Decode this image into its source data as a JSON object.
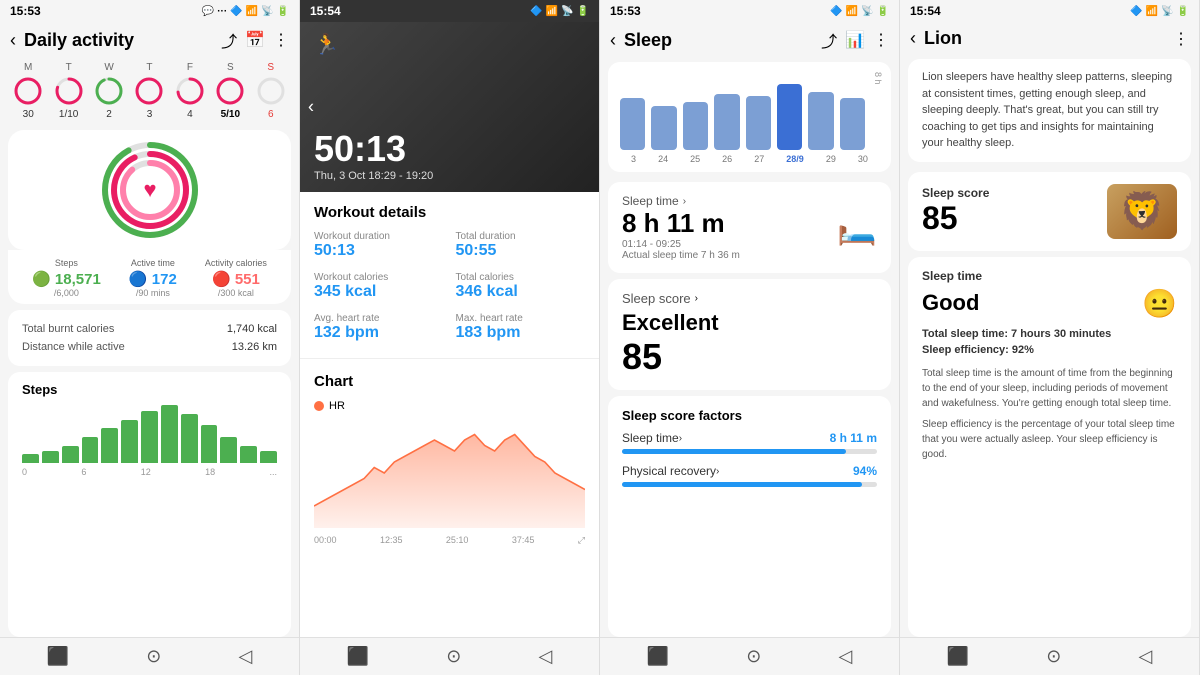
{
  "panel1": {
    "status_time": "15:53",
    "title": "Daily activity",
    "days": [
      {
        "label": "M",
        "num": "30",
        "active": false,
        "sunday": false
      },
      {
        "label": "T",
        "num": "1/10",
        "active": false,
        "sunday": false
      },
      {
        "label": "W",
        "num": "2",
        "active": false,
        "sunday": false
      },
      {
        "label": "T",
        "num": "3",
        "active": false,
        "sunday": false
      },
      {
        "label": "F",
        "num": "4",
        "active": false,
        "sunday": false
      },
      {
        "label": "S",
        "num": "5/10",
        "active": true,
        "sunday": false
      },
      {
        "label": "S",
        "num": "6",
        "active": false,
        "sunday": true
      }
    ],
    "steps_label": "Steps",
    "steps_value": "18,571",
    "steps_goal": "/6,000",
    "active_label": "Active time",
    "active_value": "172",
    "active_goal": "/90 mins",
    "cal_label": "Activity calories",
    "cal_value": "551",
    "cal_goal": "/300 kcal",
    "total_cal_label": "Total burnt calories",
    "total_cal_value": "1,740 kcal",
    "distance_label": "Distance while active",
    "distance_value": "13.26 km",
    "steps_section_title": "Steps",
    "chart_labels": [
      "0",
      "6",
      "12",
      "18",
      "..."
    ],
    "bars": [
      5,
      8,
      12,
      18,
      22,
      30,
      38,
      42,
      35,
      28,
      20,
      15,
      10
    ]
  },
  "panel2": {
    "status_time": "15:54",
    "workout_time": "50:13",
    "workout_date": "Thu, 3 Oct 18:29 - 19:20",
    "section_title": "Workout details",
    "workout_duration_label": "Workout duration",
    "workout_duration_value": "50:13",
    "total_duration_label": "Total duration",
    "total_duration_value": "50:55",
    "workout_cal_label": "Workout calories",
    "workout_cal_value": "345 kcal",
    "total_cal_label": "Total calories",
    "total_cal_value": "346 kcal",
    "avg_hr_label": "Avg. heart rate",
    "avg_hr_value": "132 bpm",
    "max_hr_label": "Max. heart rate",
    "max_hr_value": "183 bpm",
    "chart_title": "Chart",
    "hr_legend": "HR",
    "time_labels": [
      "00:00",
      "12:35",
      "25:10",
      "37:45"
    ]
  },
  "panel3": {
    "status_time": "15:53",
    "title": "Sleep",
    "date_labels": [
      "3",
      "24",
      "25",
      "26",
      "27",
      "28/9",
      "29",
      "30"
    ],
    "axis_label": "8 h",
    "sleep_time_label": "Sleep time",
    "sleep_duration": "8 h 11 m",
    "sleep_time_range": "01:14 - 09:25",
    "actual_sleep": "Actual sleep time  7 h 36 m",
    "score_section_label": "Sleep score",
    "score_quality": "Excellent",
    "score_num": "85",
    "factors_title": "Sleep score factors",
    "factor1_label": "Sleep time",
    "factor1_value": "8 h 11 m",
    "factor1_pct": 88,
    "factor2_label": "Physical recovery",
    "factor2_value": "94%",
    "factor2_pct": 94
  },
  "panel4": {
    "status_time": "15:54",
    "title": "Lion",
    "description": "Lion sleepers have healthy sleep patterns, sleeping at consistent times, getting enough sleep, and sleeping deeply. That's great, but you can still try coaching to get tips and insights for maintaining your healthy sleep.",
    "score_label": "Sleep score",
    "score_num": "85",
    "sleep_time_label": "Sleep time",
    "sleep_quality_word": "Good",
    "total_sleep": "Total sleep time: 7 hours 30 minutes",
    "efficiency": "Sleep efficiency: 92%",
    "sleep_time_desc": "Total sleep time is the amount of time from the beginning to the end of your sleep, including periods of movement and wakefulness. You're getting enough total sleep time.",
    "efficiency_desc": "Sleep efficiency is the percentage of your total sleep time that you were actually asleep. Your sleep efficiency is good."
  }
}
